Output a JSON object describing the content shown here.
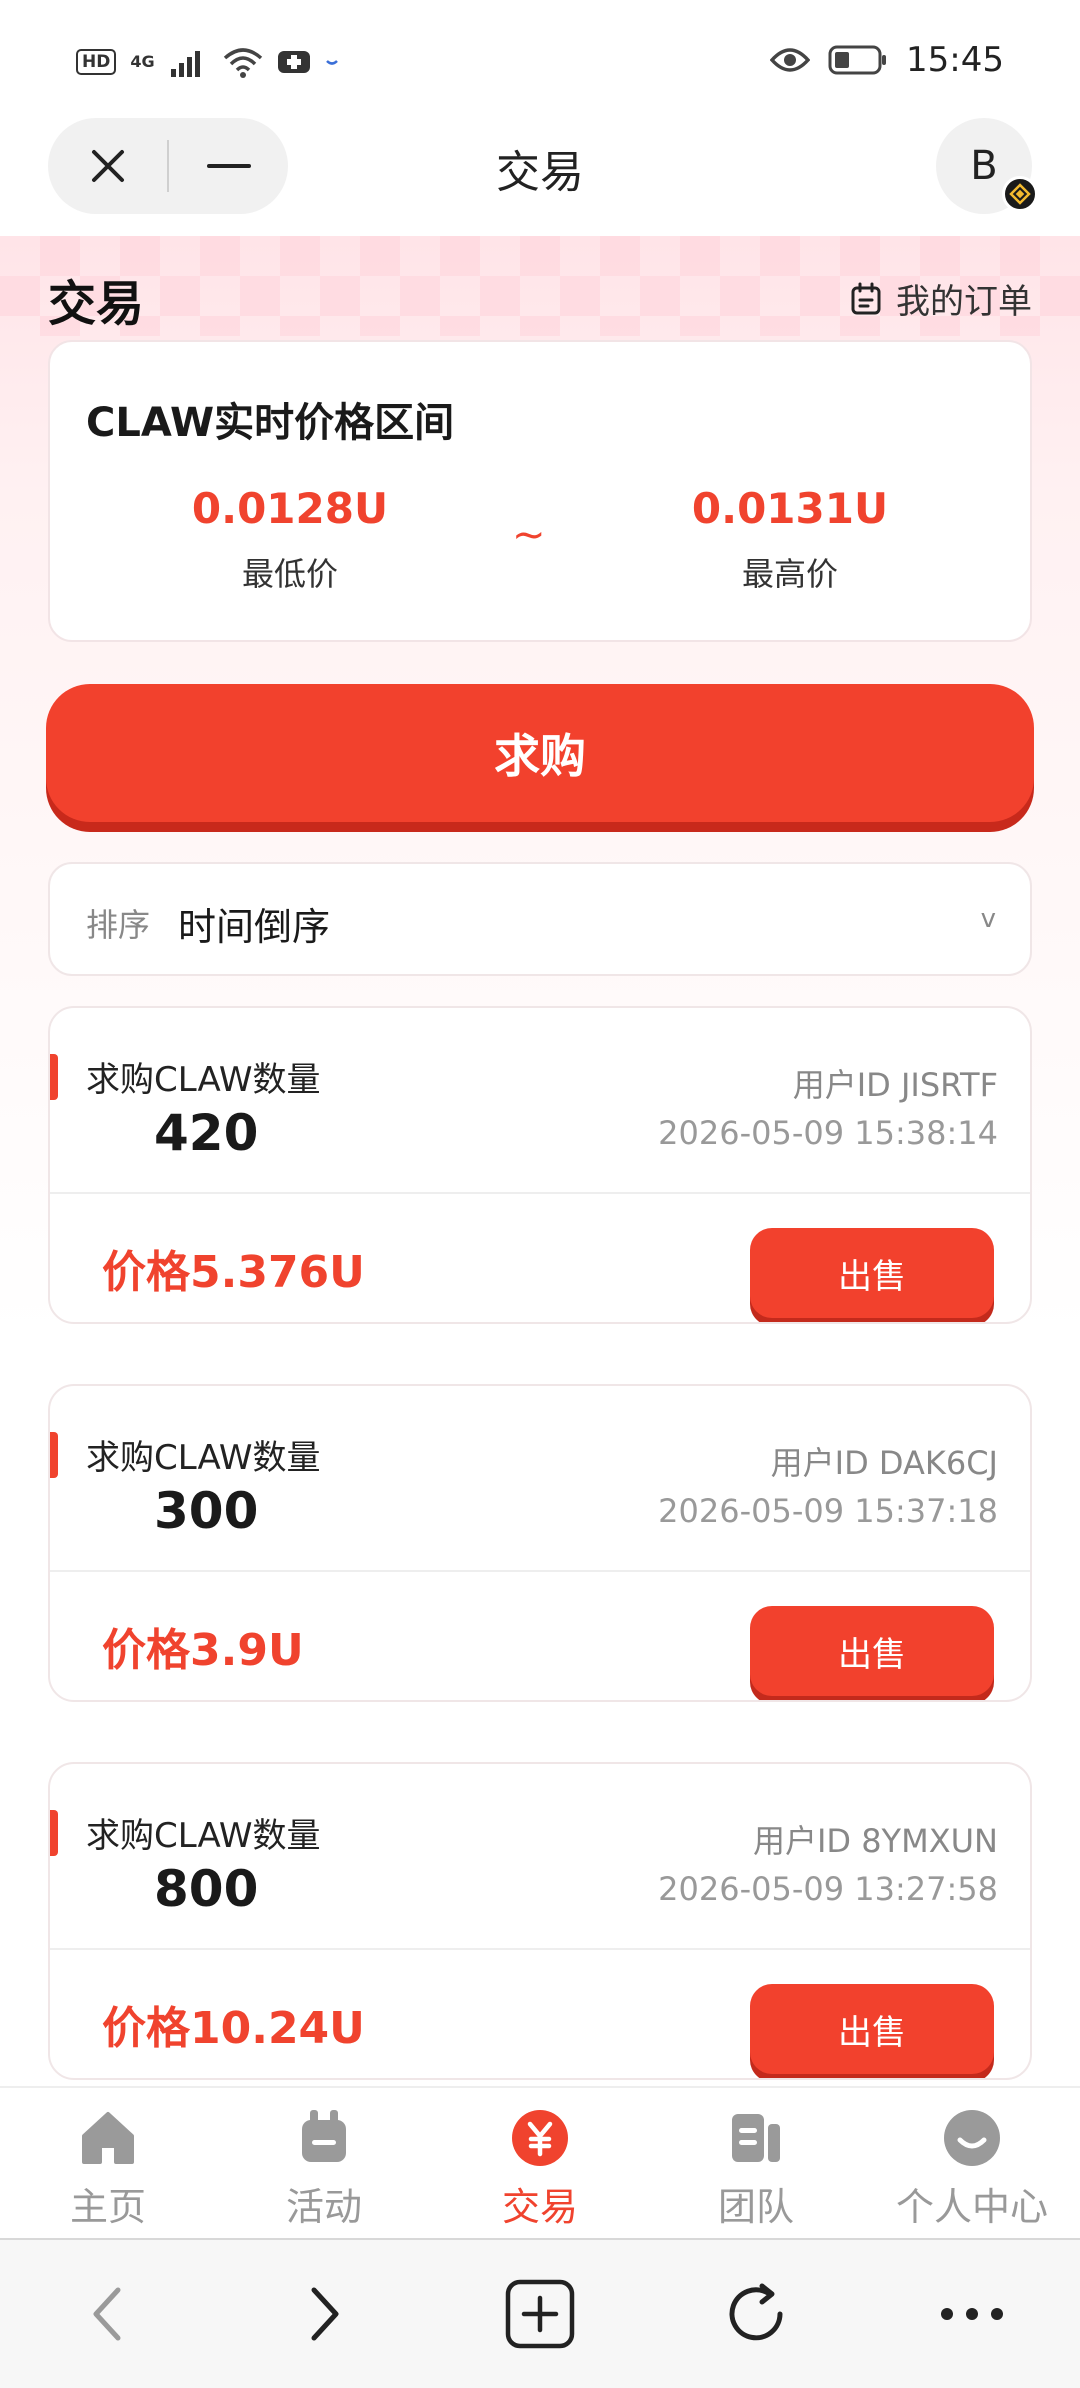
{
  "status_bar": {
    "left_badge": "HD",
    "network": "4G",
    "time": "15:45",
    "icons": [
      "hd-icon",
      "signal-icon",
      "wifi-icon",
      "health-icon",
      "eye-icon",
      "battery-icon"
    ]
  },
  "top_bar": {
    "title": "交易",
    "avatar_letter": "B",
    "icons": [
      "close-icon",
      "minimize-icon"
    ]
  },
  "section": {
    "title": "交易",
    "my_orders_label": "我的订单"
  },
  "price_range": {
    "title": "CLAW实时价格区间",
    "low_value": "0.0128U",
    "low_label": "最低价",
    "separator": "~",
    "high_value": "0.0131U",
    "high_label": "最高价"
  },
  "buy_button_label": "求购",
  "sort": {
    "label": "排序",
    "value": "时间倒序",
    "chevron": "v"
  },
  "orders": [
    {
      "qty_label": "求购CLAW数量",
      "qty": "420",
      "user_id": "用户ID JISRTF",
      "time": "2026-05-09 15:38:14",
      "price": "价格5.376U",
      "sell_label": "出售"
    },
    {
      "qty_label": "求购CLAW数量",
      "qty": "300",
      "user_id": "用户ID DAK6CJ",
      "time": "2026-05-09 15:37:18",
      "price": "价格3.9U",
      "sell_label": "出售"
    },
    {
      "qty_label": "求购CLAW数量",
      "qty": "800",
      "user_id": "用户ID 8YMXUN",
      "time": "2026-05-09 13:27:58",
      "price": "价格10.24U",
      "sell_label": "出售"
    }
  ],
  "tabs": [
    {
      "label": "主页",
      "icon": "home-icon",
      "active": false
    },
    {
      "label": "活动",
      "icon": "activity-icon",
      "active": false
    },
    {
      "label": "交易",
      "icon": "yuan-icon",
      "active": true
    },
    {
      "label": "团队",
      "icon": "team-icon",
      "active": false
    },
    {
      "label": "个人中心",
      "icon": "profile-icon",
      "active": false
    }
  ],
  "browser_bar": {
    "icons": [
      "back-icon",
      "forward-icon",
      "new-tab-icon",
      "refresh-icon",
      "more-icon"
    ]
  },
  "colors": {
    "accent": "#f0432e",
    "button": "#f2412d",
    "button_shadow": "#c8291b",
    "muted_text": "#999999"
  }
}
